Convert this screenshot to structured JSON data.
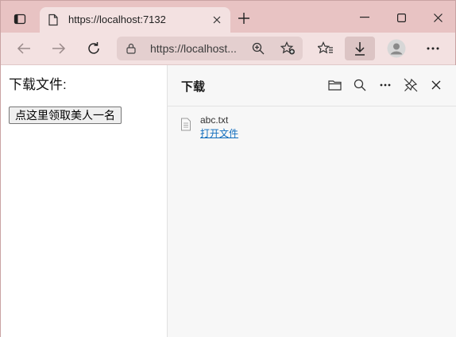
{
  "tab": {
    "title": "https://localhost:7132"
  },
  "address": {
    "url": "https://localhost..."
  },
  "page": {
    "heading": "下载文件:",
    "button_label": "点这里领取美人一名"
  },
  "downloads": {
    "title": "下载",
    "items": [
      {
        "file_name": "abc.txt",
        "action": "打开文件"
      }
    ]
  },
  "colors": {
    "titlebar": "#e8c3c3",
    "toolbar": "#f3e1e1",
    "link": "#0f6cbd"
  },
  "icons": {
    "tab_actions": "tab-actions-icon",
    "favicon": "page-icon",
    "close": "close-icon",
    "new_tab": "plus-icon",
    "minimize": "minimize-icon",
    "maximize": "maximize-icon",
    "back": "arrow-left-icon",
    "forward": "arrow-right-icon",
    "refresh": "refresh-icon",
    "lock": "lock-icon",
    "zoom": "zoom-in-icon",
    "favorite_add": "star-plus-icon",
    "favorites": "favorites-icon",
    "download": "download-icon",
    "profile": "profile-icon",
    "more": "more-icon",
    "folder": "folder-icon",
    "search": "search-icon",
    "pin": "unpin-icon",
    "file": "file-icon"
  }
}
